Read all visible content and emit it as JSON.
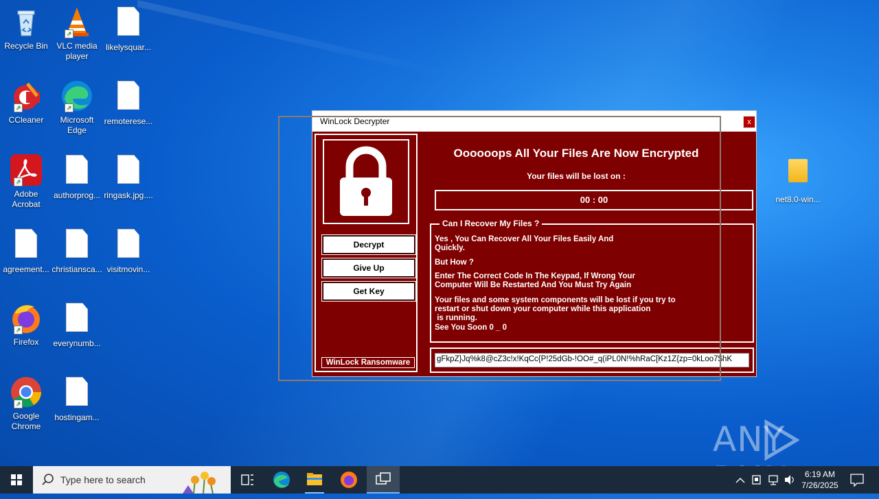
{
  "desktop": {
    "icons": [
      {
        "label": "Recycle Bin"
      },
      {
        "label": "VLC media player"
      },
      {
        "label": "likelysquar..."
      },
      {
        "label": "CCleaner"
      },
      {
        "label": "Microsoft Edge"
      },
      {
        "label": "remoterese..."
      },
      {
        "label": "Adobe Acrobat"
      },
      {
        "label": "authorprog..."
      },
      {
        "label": "ringask.jpg...."
      },
      {
        "label": "agreement..."
      },
      {
        "label": "christiansca..."
      },
      {
        "label": "visitmovin..."
      },
      {
        "label": "Firefox"
      },
      {
        "label": "everynumb..."
      },
      {
        "label": "Google Chrome"
      },
      {
        "label": "hostingam..."
      },
      {
        "label": "net8.0-win..."
      }
    ]
  },
  "window": {
    "title": "WinLock Decrypter",
    "close_label": "x",
    "headline": "Oooooops All Your Files Are Now Encrypted",
    "lost_text": "Your files will be lost on :",
    "timer": "00 : 00",
    "buttons": {
      "decrypt": "Decrypt",
      "give_up": "Give Up",
      "get_key": "Get Key"
    },
    "brand": "WinLock Ransomware",
    "group": {
      "legend": "Can I Recover My Files ?",
      "p1_line1": "Yes , You Can Recover All Your Files Easily And",
      "p1_line2": "Quickly.",
      "p2": "But How ?",
      "p3_line1": "Enter The Correct Code In The Keypad, If Wrong Your",
      "p3_line2": "Computer Will Be Restarted And You Must Try Again",
      "p4_line1": "Your files and some system components will be lost if you try to",
      "p4_line2": "restart or shut down your computer while this application",
      "p4_line3": " is running.",
      "p4_line4": "See You Soon 0 _ 0"
    },
    "key_value": "gFkpZ}Jq%k8@cZ3c!x!KqCc{P!25dGb-!OO#_q(iPL0N!%hRaC[Kz1Z{zp=0kLoo7$hK"
  },
  "watermark": {
    "text_left": "ANY",
    "text_right": "RUN"
  },
  "taskbar": {
    "search_placeholder": "Type here to search",
    "time": "6:19 AM",
    "date": "7/26/2025"
  },
  "colors": {
    "window_bg": "#7f0000",
    "accent": "#0a5dcc"
  }
}
